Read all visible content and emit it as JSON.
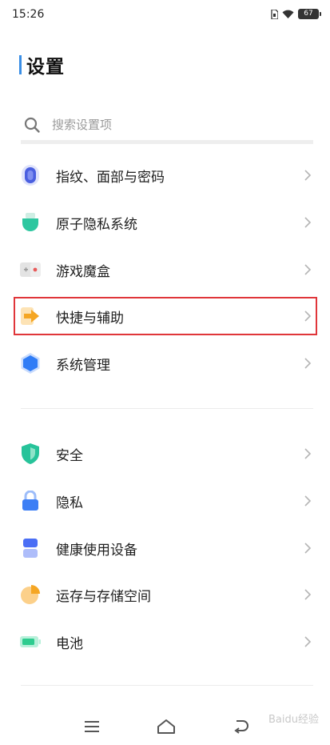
{
  "status_bar": {
    "time": "15:26",
    "battery": "67"
  },
  "title": "设置",
  "search": {
    "placeholder": "搜索设置项"
  },
  "sections": [
    {
      "items": [
        {
          "label": "指纹、面部与密码",
          "icon": "fingerprint-icon",
          "color": "#4a5fe0"
        },
        {
          "label": "原子隐私系统",
          "icon": "atom-privacy-icon",
          "color": "#2ec7a0"
        },
        {
          "label": "游戏魔盒",
          "icon": "game-box-icon",
          "color": "#e85a5a"
        },
        {
          "label": "快捷与辅助",
          "icon": "shortcut-arrow-icon",
          "color": "#f5a623",
          "highlighted": true
        },
        {
          "label": "系统管理",
          "icon": "system-hexagon-icon",
          "color": "#2f7cf6"
        }
      ]
    },
    {
      "items": [
        {
          "label": "安全",
          "icon": "shield-icon",
          "color": "#27c39a"
        },
        {
          "label": "隐私",
          "icon": "lock-icon",
          "color": "#3d7ff5"
        },
        {
          "label": "健康使用设备",
          "icon": "hourglass-icon",
          "color": "#4a6ef5"
        },
        {
          "label": "运存与存储空间",
          "icon": "storage-pie-icon",
          "color": "#f5a623"
        },
        {
          "label": "电池",
          "icon": "battery-icon",
          "color": "#2ecc8f"
        }
      ]
    }
  ],
  "watermark": "Baidu经验",
  "colors": {
    "accent": "#3a8ee6",
    "highlight_border": "#e0363a"
  }
}
